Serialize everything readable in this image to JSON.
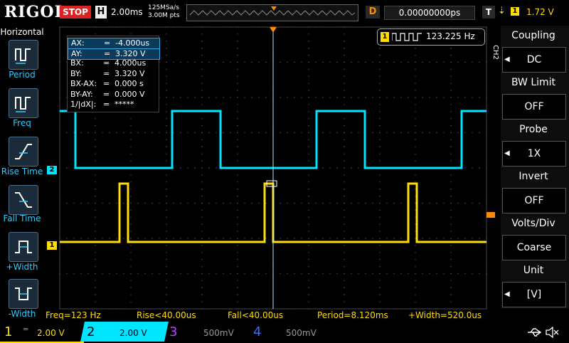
{
  "brand": "RIGOL",
  "run_state": "STOP",
  "horizontal": {
    "label": "H",
    "timebase": "2.00ms",
    "sample_rate": "125MSa/s",
    "memory_depth": "3.00M pts"
  },
  "delay": {
    "label": "D",
    "value": "0.00000000ps"
  },
  "trigger": {
    "label": "T",
    "edge": "⇣",
    "source": "1",
    "level": "1.72 V"
  },
  "left_menu": {
    "title": "Horizontal",
    "items": [
      {
        "label": "Period",
        "icon": "period-icon"
      },
      {
        "label": "Freq",
        "icon": "freq-icon"
      },
      {
        "label": "Rise Time",
        "icon": "rise-time-icon"
      },
      {
        "label": "Fall Time",
        "icon": "fall-time-icon"
      },
      {
        "label": "+Width",
        "icon": "positive-width-icon"
      },
      {
        "label": "-Width",
        "icon": "negative-width-icon"
      }
    ]
  },
  "cursors": {
    "rows": [
      {
        "name": "AX:",
        "eq": "=",
        "value": "-4.000us"
      },
      {
        "name": "AY:",
        "eq": "=",
        "value": "3.320 V"
      },
      {
        "name": "BX:",
        "eq": "=",
        "value": "4.000us"
      },
      {
        "name": "BY:",
        "eq": "=",
        "value": "3.320 V"
      },
      {
        "name": "BX-AX:",
        "eq": "=",
        "value": "0.000 s"
      },
      {
        "name": "BY-AY:",
        "eq": "=",
        "value": "0.000 V"
      },
      {
        "name": "1/|dX|:",
        "eq": "=",
        "value": "*****"
      }
    ]
  },
  "frequency_counter": {
    "channel": "1",
    "value": "123.225 Hz"
  },
  "right_menu": {
    "channel_tag": "CH2",
    "items": [
      {
        "title": "Coupling",
        "value": "DC"
      },
      {
        "title": "BW Limit",
        "value": "OFF"
      },
      {
        "title": "Probe",
        "value": "1X"
      },
      {
        "title": "Invert",
        "value": "OFF"
      },
      {
        "title": "Volts/Div",
        "value": "Coarse"
      },
      {
        "title": "Unit",
        "value": "[V]"
      }
    ]
  },
  "measurements": {
    "freq": "Freq=123 Hz",
    "rise": "Rise<40.00us",
    "fall": "Fall<40.00us",
    "period": "Period=8.120ms",
    "pwidth": "+Width=520.0us"
  },
  "channels": [
    {
      "num": "1",
      "scale": "2.00 V",
      "color": "#ffdd00"
    },
    {
      "num": "2",
      "scale": "2.00 V",
      "color": "#00e5ff"
    },
    {
      "num": "3",
      "scale": "500mV",
      "color": "#c040ff"
    },
    {
      "num": "4",
      "scale": "500mV",
      "color": "#3f6bff"
    }
  ],
  "markers": {
    "ch1": "1",
    "ch2": "2"
  },
  "status_icons": [
    "usb-icon",
    "speaker-muted-icon"
  ]
}
